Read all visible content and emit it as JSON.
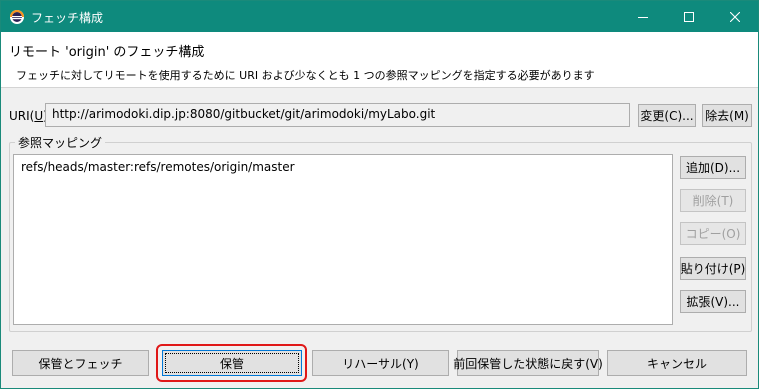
{
  "window": {
    "title": "フェッチ構成",
    "accent_color": "#0e8a7d"
  },
  "header": {
    "title": "リモート 'origin' のフェッチ構成",
    "description": "フェッチに対してリモートを使用するために URI および少なくとも 1 つの参照マッピングを指定する必要があります"
  },
  "uri": {
    "label_prefix": "URI(",
    "label_key": "U",
    "label_suffix": "):",
    "value": "http://arimodoki.dip.jp:8080/gitbucket/git/arimodoki/myLabo.git",
    "change_button": "変更(C)...",
    "remove_button": "除去(M)"
  },
  "ref_mapping": {
    "group_label": "参照マッピング",
    "items": [
      "refs/heads/master:refs/remotes/origin/master"
    ],
    "buttons": {
      "add": "追加(D)...",
      "delete": "削除(T)",
      "copy": "コピー(O)",
      "paste": "貼り付け(P)",
      "expand": "拡張(V)..."
    }
  },
  "footer": {
    "save_and_fetch": "保管とフェッチ",
    "save": "保管",
    "rehearsal": "リハーサル(Y)",
    "restore": "前回保管した状態に戻す(V)",
    "cancel": "キャンセル"
  }
}
